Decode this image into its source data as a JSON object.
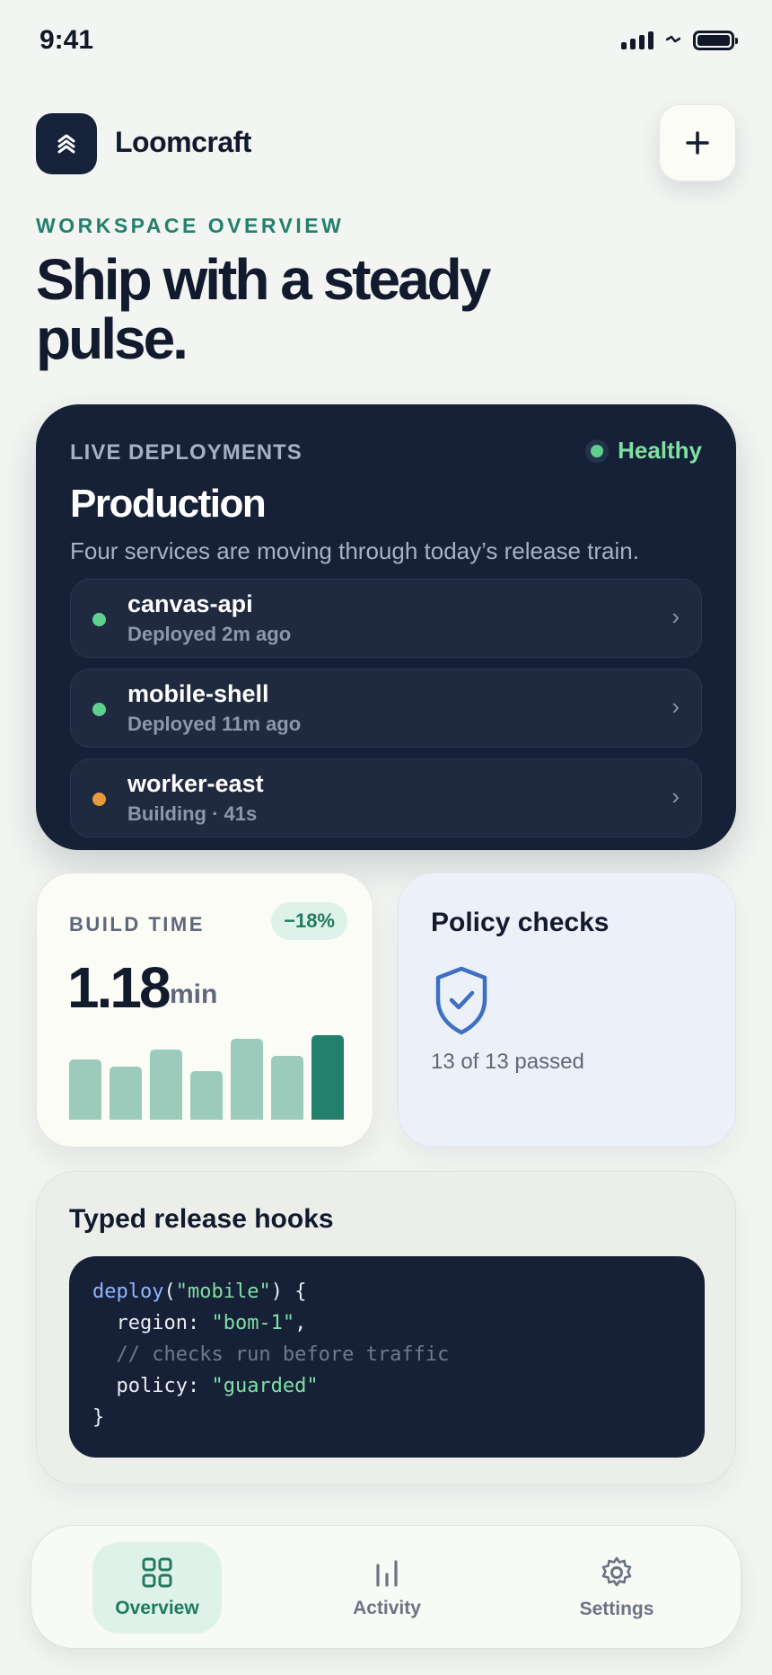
{
  "status_bar": {
    "time": "9:41"
  },
  "header": {
    "brand": "Loomcraft"
  },
  "hero": {
    "eyebrow": "WORKSPACE OVERVIEW",
    "headline": "Ship with a steady pulse."
  },
  "deployments": {
    "eyebrow": "LIVE DEPLOYMENTS",
    "status": "Healthy",
    "title": "Production",
    "subtitle": "Four services are moving through today’s release train.",
    "services": [
      {
        "name": "canvas-api",
        "meta": "Deployed 2m ago",
        "state_color": "#5fd18e"
      },
      {
        "name": "mobile-shell",
        "meta": "Deployed 11m ago",
        "state_color": "#5fd18e"
      },
      {
        "name": "worker-east",
        "meta": "Building · 41s",
        "state_color": "#e89a3a"
      }
    ]
  },
  "build_time": {
    "label": "BUILD TIME",
    "delta": "−18%",
    "value": "1.18",
    "unit": "min",
    "bars": [
      0.71,
      0.63,
      0.83,
      0.57,
      0.96,
      0.76,
      1.0
    ],
    "bar_color": "#9ccbbc",
    "highlight_color": "#23806b"
  },
  "policy": {
    "title": "Policy checks",
    "icon": "shield-check-icon",
    "summary": "13 of 13 passed"
  },
  "hooks": {
    "title": "Typed release hooks",
    "code": [
      [
        {
          "t": "deploy",
          "k": "fn"
        },
        {
          "t": "(",
          "k": "plain"
        },
        {
          "t": "\"mobile\"",
          "k": "str"
        },
        {
          "t": ") {",
          "k": "plain"
        }
      ],
      [
        {
          "t": "  region: ",
          "k": "plain"
        },
        {
          "t": "\"bom-1\"",
          "k": "str"
        },
        {
          "t": ",",
          "k": "plain"
        }
      ],
      [
        {
          "t": "  // checks run before traffic",
          "k": "comment"
        }
      ],
      [
        {
          "t": "  policy: ",
          "k": "plain"
        },
        {
          "t": "\"guarded\"",
          "k": "str"
        }
      ],
      [
        {
          "t": "}",
          "k": "plain"
        }
      ]
    ]
  },
  "nav": {
    "tabs": [
      {
        "label": "Overview",
        "icon": "grid-icon",
        "active": true
      },
      {
        "label": "Activity",
        "icon": "bar-chart-icon",
        "active": false
      },
      {
        "label": "Settings",
        "icon": "gear-icon",
        "active": false
      }
    ]
  },
  "colors": {
    "accent": "#23806b",
    "navy": "#162037",
    "healthy": "#7ee0a3"
  }
}
